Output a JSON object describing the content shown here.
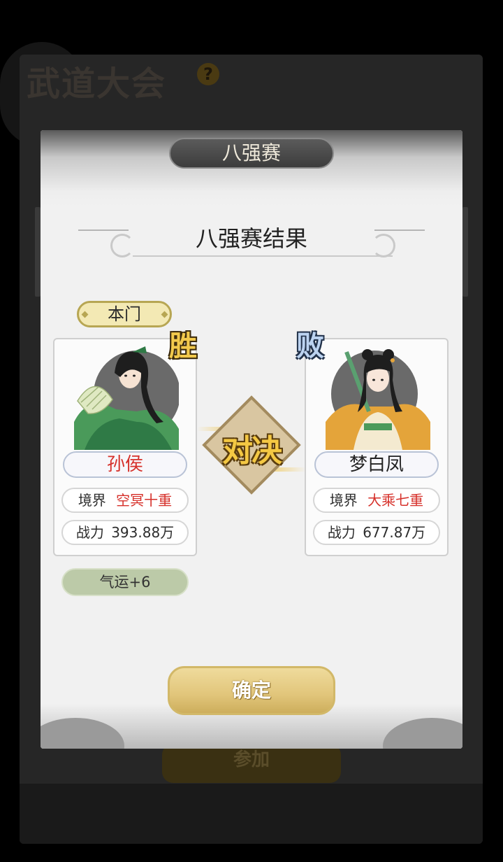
{
  "background": {
    "title": "武道大会",
    "help_icon": "?",
    "join_label": "参加"
  },
  "modal": {
    "title": "八强赛",
    "result_heading": "八强赛结果"
  },
  "left_fighter": {
    "sect_tag": "本门",
    "result": "胜",
    "name": "孙侯",
    "realm_label": "境界",
    "realm_value": "空冥十重",
    "power_label": "战力",
    "power_value": "393.88万",
    "portrait_icon": "green-robed-swordsman-portrait",
    "reward": "气运+6"
  },
  "right_fighter": {
    "result": "败",
    "name": "梦白凤",
    "realm_label": "境界",
    "realm_value": "大乘七重",
    "power_label": "战力",
    "power_value": "677.87万",
    "portrait_icon": "orange-robed-maiden-portrait"
  },
  "versus_label": "对决",
  "confirm_label": "确定",
  "colors": {
    "win_gold": "#f2c94c",
    "lose_blue": "#bcd3f0",
    "realm_red": "#d6302a",
    "confirm_gold": "#e1c57a",
    "reward_green": "#bccaa8"
  }
}
